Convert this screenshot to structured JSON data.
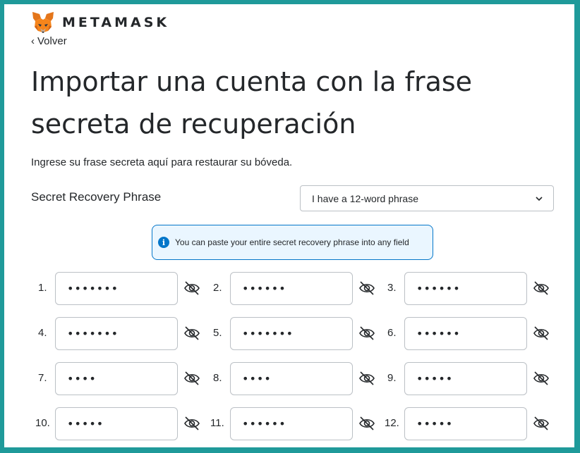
{
  "brand": {
    "name": "METAMASK",
    "logo": "fox-logo"
  },
  "nav": {
    "back_label": "Volver"
  },
  "page": {
    "title": "Importar una cuenta con la frase secreta de recuperación",
    "subtitle": "Ingrese su frase secreta aquí para restaurar su bóveda."
  },
  "srp": {
    "label": "Secret Recovery Phrase",
    "select_value": "I have a 12-word phrase"
  },
  "info": {
    "icon": "info-icon",
    "text": "You can paste your entire secret recovery phrase into any field"
  },
  "words": [
    {
      "index": "1.",
      "value": "•••••••"
    },
    {
      "index": "2.",
      "value": "••••••"
    },
    {
      "index": "3.",
      "value": "••••••"
    },
    {
      "index": "4.",
      "value": "•••••••"
    },
    {
      "index": "5.",
      "value": "•••••••"
    },
    {
      "index": "6.",
      "value": "••••••"
    },
    {
      "index": "7.",
      "value": "••••"
    },
    {
      "index": "8.",
      "value": "••••"
    },
    {
      "index": "9.",
      "value": "•••••"
    },
    {
      "index": "10.",
      "value": "•••••"
    },
    {
      "index": "11.",
      "value": "••••••"
    },
    {
      "index": "12.",
      "value": "•••••"
    }
  ],
  "colors": {
    "accent": "#0376c9",
    "info_bg": "#eaf6ff",
    "text": "#24272a",
    "border": "#bbc0c5",
    "frame": "#1f9a9a"
  }
}
